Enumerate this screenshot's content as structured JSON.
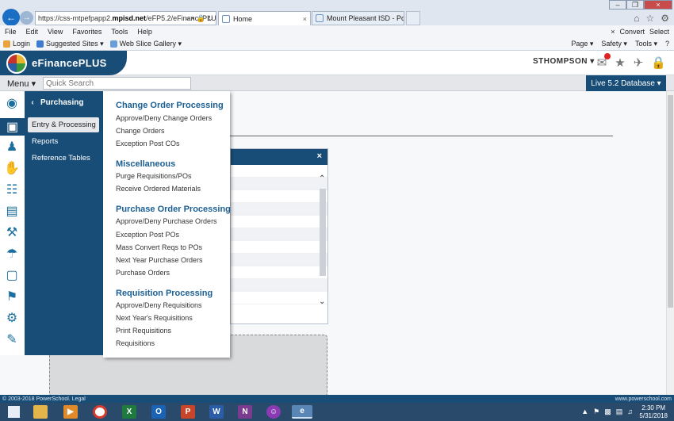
{
  "browser": {
    "address_prefix": "https://css-mtpefpapp2.",
    "address_host": "mpisd.net",
    "address_rest": "/eFP5.2/eFinancePLU",
    "address_tail": "⌕ ▾ 🔒 ↻",
    "tabs": [
      {
        "label": "Home",
        "close": "×"
      },
      {
        "label": "Mount Pleasant ISD - Policy O...",
        "close": ""
      }
    ],
    "window_controls": [
      "–",
      "❐",
      "×"
    ],
    "menubar": [
      "File",
      "Edit",
      "View",
      "Favorites",
      "Tools",
      "Help"
    ],
    "menubar_right": {
      "close": "×",
      "convert": "Convert",
      "select": "Select"
    },
    "favorites": [
      {
        "label": "Login",
        "color": "#e8a33d"
      },
      {
        "label": "Suggested Sites ▾",
        "color": "#3f7bd0"
      },
      {
        "label": "Web Slice Gallery ▾",
        "color": "#6a9ed8"
      }
    ],
    "command_bar": [
      "Page ▾",
      "Safety ▾",
      "Tools ▾",
      "?"
    ]
  },
  "app": {
    "name": "eFinancePLUS",
    "user": "STHOMPSON ▾",
    "menu_label": "Menu ▾",
    "search_placeholder": "Quick Search",
    "database_label": "Live 5.2 Database ▾",
    "dialog_close": "×",
    "scroll_up": "⌃",
    "scroll_down": "⌄"
  },
  "sidebar": {
    "back": "‹",
    "title": "Purchasing",
    "items": [
      {
        "label": "Entry & Processing"
      },
      {
        "label": "Reports"
      },
      {
        "label": "Reference Tables"
      }
    ]
  },
  "flyout": {
    "sections": [
      {
        "heading": "Change Order Processing",
        "items": [
          "Approve/Deny Change Orders",
          "Change Orders",
          "Exception Post COs"
        ]
      },
      {
        "heading": "Miscellaneous",
        "items": [
          "Purge Requisitions/POs",
          "Receive Ordered Materials"
        ]
      },
      {
        "heading": "Purchase Order Processing",
        "items": [
          "Approve/Deny Purchase Orders",
          "Exception Post POs",
          "Mass Convert Reqs to POs",
          "Next Year Purchase Orders",
          "Purchase Orders"
        ]
      },
      {
        "heading": "Requisition Processing",
        "items": [
          "Approve/Deny Requisitions",
          "Next Year's Requisitions",
          "Print Requisitions",
          "Requisitions"
        ]
      }
    ]
  },
  "status": {
    "left": "© 2003-2018 PowerSchool. Legal",
    "right": "www.powerschool.com"
  },
  "taskbar": {
    "time": "2:30 PM",
    "date": "5/31/2018",
    "apps": [
      "X",
      "O",
      "P",
      "W",
      "N"
    ]
  },
  "colors": {
    "brand": "#184d78",
    "accent": "#1b5f93"
  }
}
